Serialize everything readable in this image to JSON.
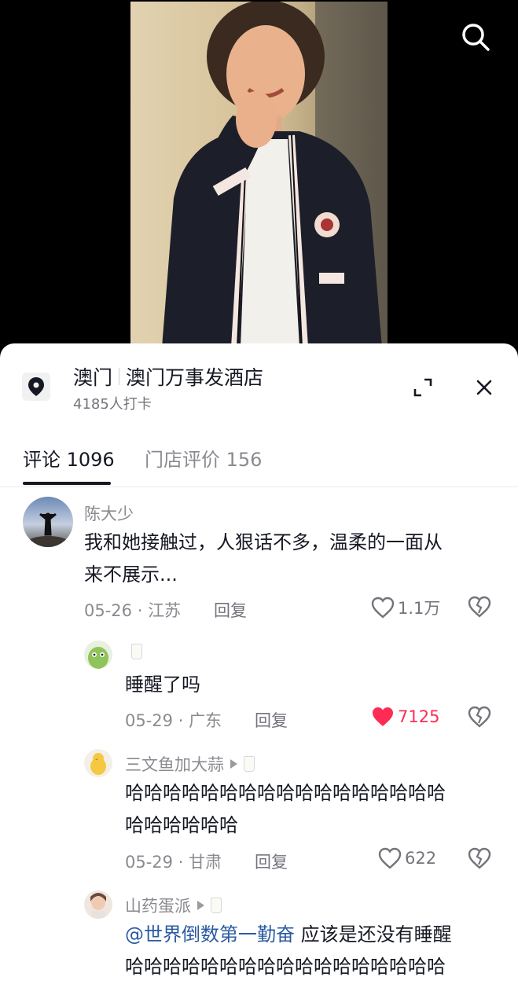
{
  "header": {
    "search_icon": "search-icon"
  },
  "poi": {
    "city": "澳门",
    "name": "澳门万事发酒店",
    "checkins": "4185人打卡"
  },
  "tabs": [
    {
      "label": "评论 1096"
    },
    {
      "label": "门店评价 156"
    }
  ],
  "comments": [
    {
      "user": "陈大少",
      "text_line1": "我和她接触过，人狠话不多，温柔的一面从",
      "text_line2": "来不展示...",
      "date": "05-26",
      "location": "江苏",
      "reply_label": "回复",
      "likes": "1.1万"
    },
    {
      "user": "",
      "text": "睡醒了吗",
      "date": "05-29",
      "location": "广东",
      "reply_label": "回复",
      "likes": "7125",
      "liked": true
    },
    {
      "user": "三文鱼加大蒜",
      "text_line1": "哈哈哈哈哈哈哈哈哈哈哈哈哈哈哈哈哈",
      "text_line2": "哈哈哈哈哈哈",
      "date": "05-29",
      "location": "甘肃",
      "reply_label": "回复",
      "likes": "622"
    },
    {
      "user": "山药蛋派",
      "mention": "@世界倒数第一勤奋",
      "text_line1_rest": " 应该是还没有睡醒",
      "text_line2": "哈哈哈哈哈哈哈哈哈哈哈哈哈哈哈哈哈"
    }
  ],
  "colors": {
    "liked_red": "#fe2c55",
    "mention_blue": "#2b5aa0",
    "secondary_text": "#8a8b91"
  }
}
